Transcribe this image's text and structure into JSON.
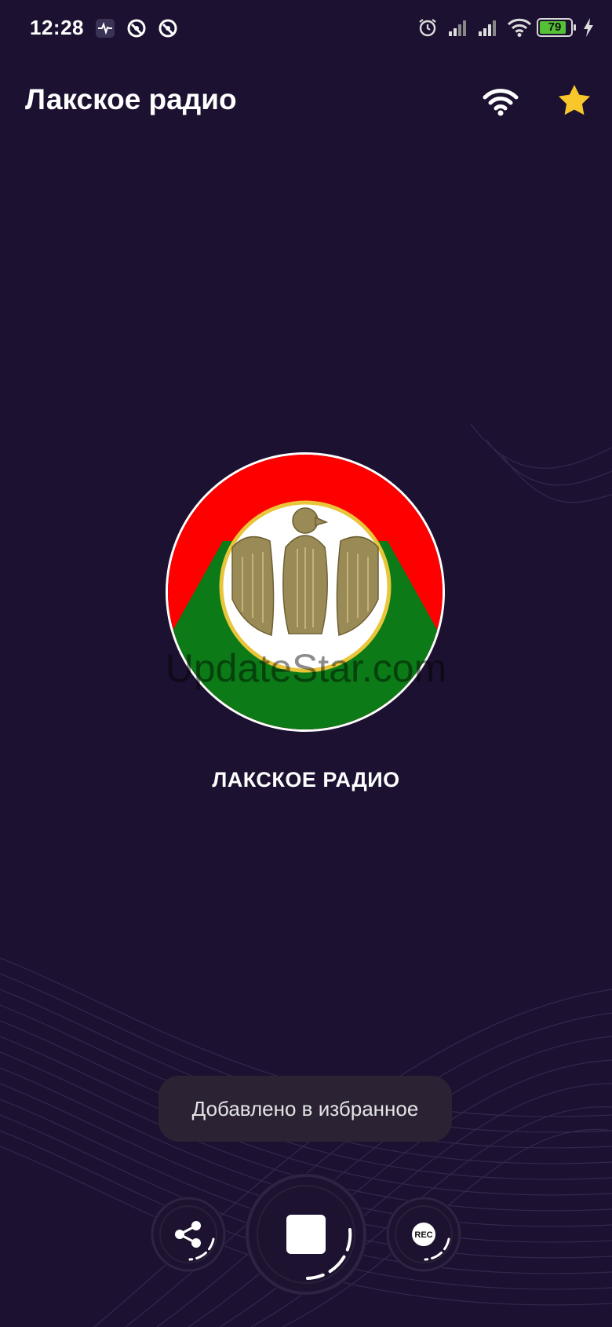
{
  "status_bar": {
    "time": "12:28",
    "battery_level": "79",
    "icons": [
      "activity-icon",
      "vpn-icon",
      "vpn-icon",
      "alarm-icon",
      "signal-icon",
      "signal-icon",
      "wifi-icon",
      "battery-icon",
      "charging-icon"
    ]
  },
  "app_bar": {
    "title": "Лакское радио",
    "wifi_icon": "wifi-icon",
    "favorite_icon": "star-icon"
  },
  "station": {
    "name": "ЛАКСКОЕ РАДИО",
    "logo_colors": [
      "#ff0000",
      "#ffffff",
      "#0b7a17"
    ]
  },
  "watermark": "UpdateStar.com",
  "toast": {
    "message": "Добавлено в избранное"
  },
  "controls": {
    "share_icon": "share-icon",
    "stop_icon": "stop-icon",
    "rec_label": "REC"
  },
  "colors": {
    "background": "#1c1130",
    "star": "#f7c72b",
    "battery": "#55c136"
  }
}
